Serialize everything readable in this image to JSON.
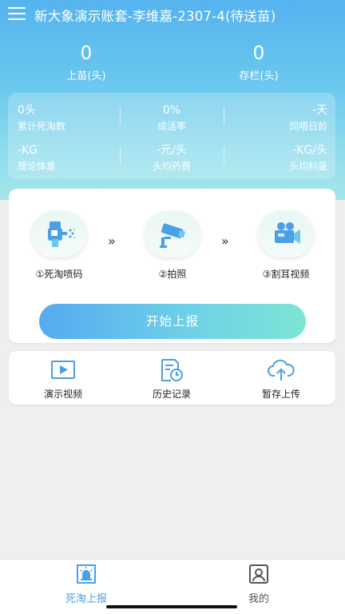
{
  "header": {
    "title": "新大象演示账套-李维嘉-2307-4(待送苗)"
  },
  "top_stats": [
    {
      "value": "0",
      "label": "上苗(头)"
    },
    {
      "value": "0",
      "label": "存栏(头)"
    }
  ],
  "stats": [
    {
      "value": "0头",
      "label": "累计死淘数"
    },
    {
      "value": "0%",
      "label": "成活率"
    },
    {
      "value": "-天",
      "label": "饲喂日龄"
    },
    {
      "value": "-KG",
      "label": "理论体重"
    },
    {
      "value": "-元/头",
      "label": "头均药费"
    },
    {
      "value": "-KG/头",
      "label": "头均料量"
    }
  ],
  "steps": [
    {
      "label": "①死淘喷码",
      "icon": "spray-gun-icon"
    },
    {
      "label": "②拍照",
      "icon": "camera-icon"
    },
    {
      "label": "③割耳视频",
      "icon": "video-camera-icon"
    }
  ],
  "step_arrow": "»",
  "start_button": "开始上报",
  "tools": [
    {
      "label": "演示视频",
      "icon": "play-video-icon"
    },
    {
      "label": "历史记录",
      "icon": "history-icon"
    },
    {
      "label": "暂存上传",
      "icon": "cloud-upload-icon"
    }
  ],
  "tabs": [
    {
      "label": "死淘上报",
      "icon": "report-alarm-icon",
      "active": true
    },
    {
      "label": "我的",
      "icon": "profile-icon",
      "active": false
    }
  ],
  "colors": {
    "accent": "#4a9fe6",
    "inactive": "#555555"
  }
}
